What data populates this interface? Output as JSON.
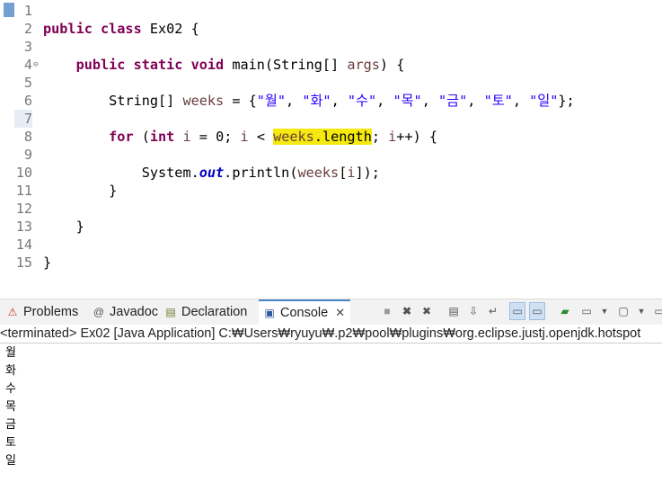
{
  "editor": {
    "lines": [
      {
        "n": "1"
      },
      {
        "n": "2",
        "t": [
          {
            "c": "kw",
            "v": "public class"
          },
          {
            "v": " Ex02 {"
          }
        ]
      },
      {
        "n": "3"
      },
      {
        "n": "4",
        "fold": "⊖",
        "t": [
          {
            "v": "    "
          },
          {
            "c": "kw",
            "v": "public static void"
          },
          {
            "v": " main(String[] "
          },
          {
            "c": "var",
            "v": "args"
          },
          {
            "v": ") {"
          }
        ]
      },
      {
        "n": "5"
      },
      {
        "n": "6",
        "t": [
          {
            "v": "        String[] "
          },
          {
            "c": "var",
            "v": "weeks"
          },
          {
            "v": " = {"
          },
          {
            "c": "str",
            "v": "\"월\""
          },
          {
            "v": ", "
          },
          {
            "c": "str",
            "v": "\"화\""
          },
          {
            "v": ", "
          },
          {
            "c": "str",
            "v": "\"수\""
          },
          {
            "v": ", "
          },
          {
            "c": "str",
            "v": "\"목\""
          },
          {
            "v": ", "
          },
          {
            "c": "str",
            "v": "\"금\""
          },
          {
            "v": ", "
          },
          {
            "c": "str",
            "v": "\"토\""
          },
          {
            "v": ", "
          },
          {
            "c": "str",
            "v": "\"일\""
          },
          {
            "v": "};"
          }
        ]
      },
      {
        "n": "7",
        "hl": true
      },
      {
        "n": "8",
        "t": [
          {
            "v": "        "
          },
          {
            "c": "kw",
            "v": "for"
          },
          {
            "v": " ("
          },
          {
            "c": "kw",
            "v": "int"
          },
          {
            "v": " "
          },
          {
            "c": "var",
            "v": "i"
          },
          {
            "v": " = 0; "
          },
          {
            "c": "var",
            "v": "i"
          },
          {
            "v": " < "
          },
          {
            "c": "var mark",
            "v": "weeks"
          },
          {
            "c": "mark",
            "v": ".length"
          },
          {
            "v": "; "
          },
          {
            "c": "var",
            "v": "i"
          },
          {
            "v": "++) {"
          }
        ]
      },
      {
        "n": "9"
      },
      {
        "n": "10",
        "t": [
          {
            "v": "            System."
          },
          {
            "c": "fld",
            "v": "out"
          },
          {
            "v": ".println("
          },
          {
            "c": "var",
            "v": "weeks"
          },
          {
            "v": "["
          },
          {
            "c": "var",
            "v": "i"
          },
          {
            "v": "]);"
          }
        ]
      },
      {
        "n": "11",
        "t": [
          {
            "v": "        }"
          }
        ]
      },
      {
        "n": "12"
      },
      {
        "n": "13",
        "t": [
          {
            "v": "    }"
          }
        ]
      },
      {
        "n": "14"
      },
      {
        "n": "15",
        "t": [
          {
            "v": "}"
          }
        ]
      }
    ]
  },
  "tabs": {
    "problems": "Problems",
    "javadoc": "Javadoc",
    "declaration": "Declaration",
    "console": "Console"
  },
  "console": {
    "header": "<terminated> Ex02 [Java Application] C:₩Users₩ryuyu₩.p2₩pool₩plugins₩org.eclipse.justj.openjdk.hotspot",
    "output": [
      "월",
      "화",
      "수",
      "목",
      "금",
      "토",
      "일"
    ]
  },
  "colors": {
    "keyword": "#7f0055",
    "variable": "#6a3e3e",
    "string": "#2a00ff",
    "static_field": "#0000c0",
    "occurrence_highlight": "#f5e90f"
  }
}
